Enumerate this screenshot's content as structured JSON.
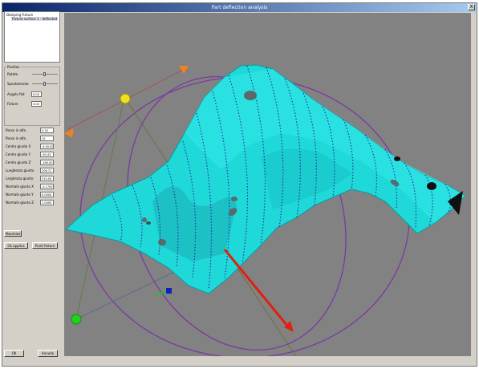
{
  "window": {
    "title": "Part deflection analysis",
    "close_label": "X"
  },
  "tree": {
    "root": "Damping Fixture",
    "child": "Fixture surface 1 - deflected"
  },
  "position_group": {
    "caption": "Position",
    "rows": [
      {
        "label": "Rotate",
        "value": ""
      },
      {
        "label": "Spostamento",
        "value": ""
      },
      {
        "label": "Angolo fixt",
        "value": "0.00"
      },
      {
        "label": "Fixture",
        "value": "0.00"
      }
    ]
  },
  "params": [
    {
      "label": "Passo in alfa",
      "value": "0.30"
    },
    {
      "label": "Passo in alfa",
      "value": "10"
    },
    {
      "label": "Centro giunto X",
      "value": "-9.50.00"
    },
    {
      "label": "Centro giunto Y",
      "value": "-90.43"
    },
    {
      "label": "Centro giunto Z",
      "value": "-180.00"
    },
    {
      "label": "Lunghezza giunto",
      "value": "206.72"
    },
    {
      "label": "Larghezza giunto",
      "value": "315.00"
    },
    {
      "label": "Normale giunto X",
      "value": "-0.1700"
    },
    {
      "label": "Normale giunto Y",
      "value": "0.0000"
    },
    {
      "label": "Normale giunto Z",
      "value": "1.0000"
    }
  ],
  "buttons": {
    "maximize": "Maximize",
    "apply": "Ok applica",
    "reset": "Punti fixture",
    "ok": "OK",
    "cancel": "Annulla"
  },
  "colors": {
    "surface": "#1fd8d8",
    "scan_lines": "#2a2aa0",
    "gizmo_ring": "#7a3aa0",
    "viewport_bg": "#828282",
    "arrow": "#e02010",
    "handle_yellow": "#f0e020",
    "handle_green": "#20d020",
    "handle_orange": "#f08020"
  }
}
